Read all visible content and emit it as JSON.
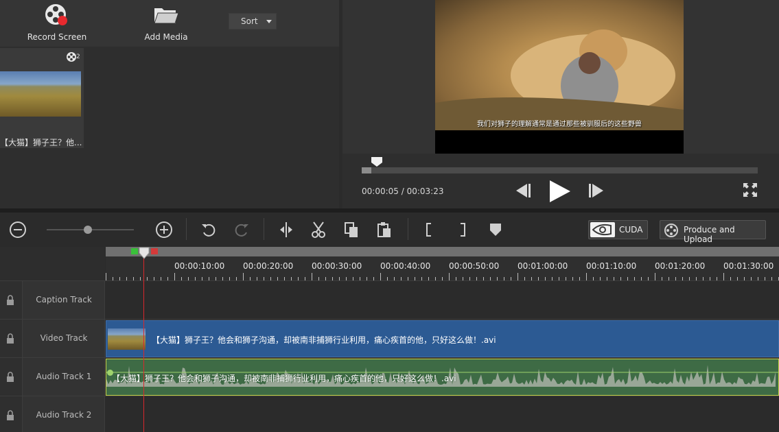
{
  "media_toolbar": {
    "record_label": "Record Screen",
    "add_media_label": "Add Media",
    "sort_label": "Sort"
  },
  "media_library": {
    "items": [
      {
        "name": "【大猫】狮子王？他...",
        "clip_count": "2"
      }
    ]
  },
  "preview": {
    "subtitle": "我们对狮子的理解通常是通过那些被驯服后的这些野兽",
    "current_time": "00:00:05",
    "total_time": "00:03:23",
    "progress": 0.025
  },
  "timeline_toolbar": {
    "zoom_level": 0.47,
    "cuda_label": "CUDA",
    "produce_label": "Produce and Upload"
  },
  "ruler": {
    "labels": [
      "00:00:10:00",
      "00:00:20:00",
      "00:00:30:00",
      "00:00:40:00",
      "00:00:50:00",
      "00:01:00:00",
      "00:01:10:00",
      "00:01:20:00",
      "00:01:30:00"
    ]
  },
  "tracks": {
    "caption": {
      "label": "Caption Track"
    },
    "video": {
      "label": "Video Track",
      "clip_name": "【大猫】狮子王？他会和狮子沟通，却被南非捕狮行业利用，痛心疾首的他，只好这么做！.avi"
    },
    "audio1": {
      "label": "Audio Track 1",
      "clip_name": "【大猫】狮子王？他会和狮子沟通，却被南非捕狮行业利用，痛心疾首的他，只好这么做！.avi"
    },
    "audio2": {
      "label": "Audio Track 2"
    }
  },
  "colors": {
    "video_clip": "#2c5a93",
    "audio_clip": "#3e6b45",
    "playhead": "#d8282c",
    "accent_record": "#e8292e"
  },
  "icons": {
    "record": "film-reel-record-icon",
    "add_media": "folder-icon",
    "zoom_out": "minus-circle-icon",
    "zoom_in": "plus-circle-icon",
    "undo": "undo-icon",
    "redo": "redo-icon",
    "split": "split-icon",
    "cut": "scissors-icon",
    "copy": "copy-icon",
    "paste": "paste-icon",
    "mark_in": "mark-in-icon",
    "mark_out": "mark-out-icon",
    "marker": "marker-icon",
    "lock": "lock-icon"
  }
}
